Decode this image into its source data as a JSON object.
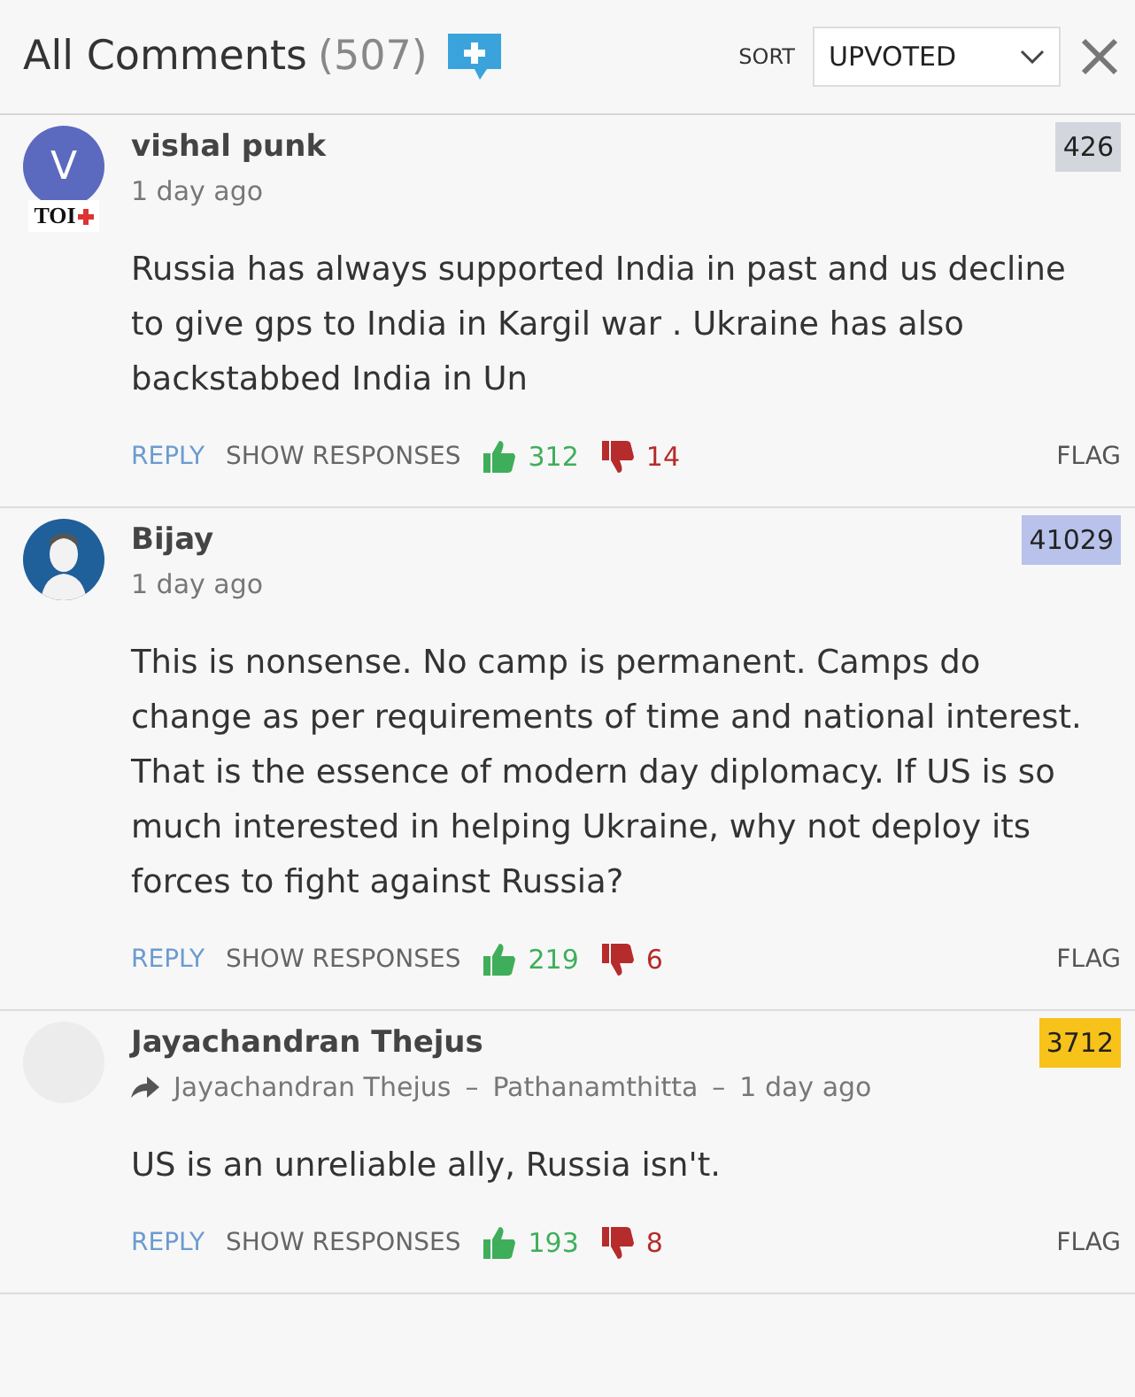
{
  "header": {
    "title": "All Comments",
    "count": "(507)",
    "sort_label": "SORT",
    "sort_value": "UPVOTED"
  },
  "comments": [
    {
      "avatar": {
        "kind": "letter",
        "letter": "V",
        "color": "#5b6abf",
        "tag": "TOI"
      },
      "name": "vishal punk",
      "badge": "426",
      "color": "#d3d6dc",
      "time": "1 day ago",
      "text": "Russia has always supported India in past and us decline to give gps to India in Kargil war . Ukraine has also backstabbed India in Un",
      "actions": {
        "reply": "REPLY",
        "show": "SHOW RESPONSES",
        "up": "312",
        "down": "14",
        "flag": "FLAG"
      }
    },
    {
      "avatar": {
        "kind": "silhouette",
        "color": "#1f5f9a"
      },
      "name": "Bijay",
      "badge": "41029",
      "color": "#b8c2ea",
      "time": "1 day ago",
      "text": "This is nonsense. No camp is permanent. Camps do change as per requirements of time and national interest. That is the essence of modern day diplomacy. If US is so much interested in helping Ukraine, why not deploy its forces to fight against Russia?",
      "actions": {
        "reply": "REPLY",
        "show": "SHOW RESPONSES",
        "up": "219",
        "down": "6",
        "flag": "FLAG"
      }
    },
    {
      "avatar": {
        "kind": "blank",
        "color": "#ececec"
      },
      "name": "Jayachandran Thejus",
      "badge": "3712",
      "color": "#f7c21a",
      "reply_to": {
        "name": "Jayachandran Thejus",
        "separator": "–",
        "place": "Pathanamthitta",
        "separator_2": "–",
        "time": "1 day ago"
      },
      "text": "US is an unreliable ally, Russia isn't.",
      "actions": {
        "reply": "REPLY",
        "show": "SHOW RESPONSES",
        "up": "193",
        "down": "8",
        "flag": "FLAG"
      }
    }
  ]
}
